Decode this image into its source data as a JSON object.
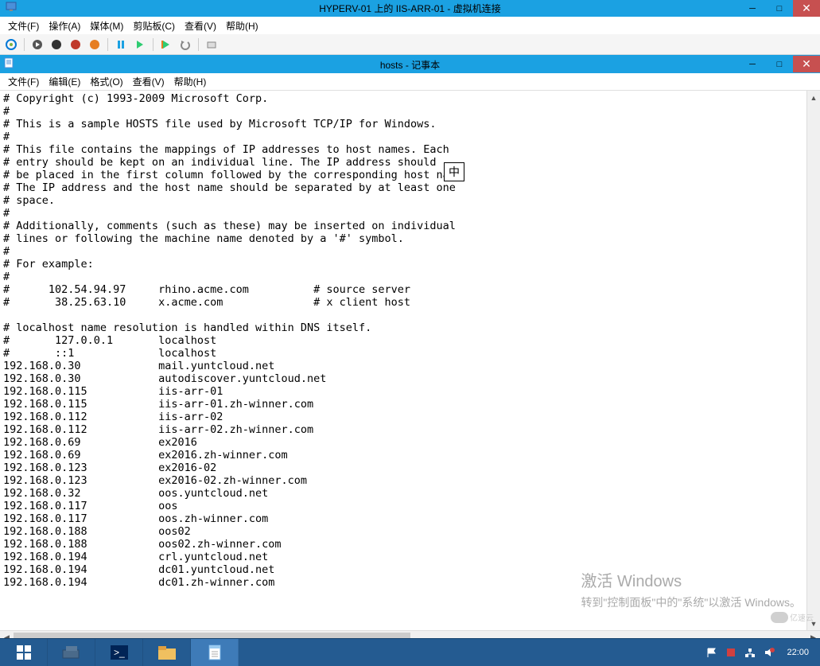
{
  "outer_window": {
    "title": "HYPERV-01 上的 IIS-ARR-01 - 虚拟机连接",
    "menu": [
      "文件(F)",
      "操作(A)",
      "媒体(M)",
      "剪贴板(C)",
      "查看(V)",
      "帮助(H)"
    ]
  },
  "toolbar": {
    "items": [
      "connect",
      "start",
      "stop",
      "shutdown",
      "save",
      "pause",
      "resume",
      "checkpoint",
      "revert",
      "share"
    ]
  },
  "inner_window": {
    "title": "hosts - 记事本",
    "menu": [
      "文件(F)",
      "编辑(E)",
      "格式(O)",
      "查看(V)",
      "帮助(H)"
    ]
  },
  "text_content": "# Copyright (c) 1993-2009 Microsoft Corp.\n#\n# This is a sample HOSTS file used by Microsoft TCP/IP for Windows.\n#\n# This file contains the mappings of IP addresses to host names. Each\n# entry should be kept on an individual line. The IP address should\n# be placed in the first column followed by the corresponding host na\n# The IP address and the host name should be separated by at least one\n# space.\n#\n# Additionally, comments (such as these) may be inserted on individual\n# lines or following the machine name denoted by a '#' symbol.\n#\n# For example:\n#\n#      102.54.94.97     rhino.acme.com          # source server\n#       38.25.63.10     x.acme.com              # x client host\n\n# localhost name resolution is handled within DNS itself.\n#       127.0.0.1       localhost\n#       ::1             localhost\n192.168.0.30            mail.yuntcloud.net\n192.168.0.30            autodiscover.yuntcloud.net\n192.168.0.115           iis-arr-01\n192.168.0.115           iis-arr-01.zh-winner.com\n192.168.0.112           iis-arr-02\n192.168.0.112           iis-arr-02.zh-winner.com\n192.168.0.69            ex2016\n192.168.0.69            ex2016.zh-winner.com\n192.168.0.123           ex2016-02\n192.168.0.123           ex2016-02.zh-winner.com\n192.168.0.32            oos.yuntcloud.net\n192.168.0.117           oos\n192.168.0.117           oos.zh-winner.com\n192.168.0.188           oos02\n192.168.0.188           oos02.zh-winner.com\n192.168.0.194           crl.yuntcloud.net\n192.168.0.194           dc01.yuntcloud.net\n192.168.0.194           dc01.zh-winner.com",
  "ime_indicator": "中",
  "watermark": {
    "title": "激活 Windows",
    "subtitle": "转到\"控制面板\"中的\"系统\"以激活 Windows。"
  },
  "cloud_wm_text": "亿速云",
  "tray": {
    "time": "22:00",
    "date": "___"
  }
}
